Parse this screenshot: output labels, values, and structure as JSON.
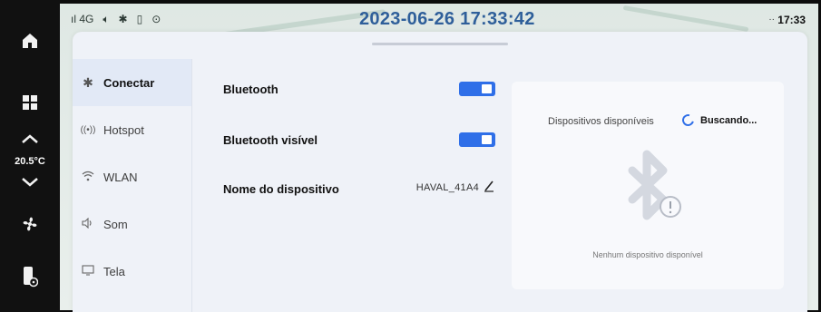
{
  "status_bar": {
    "signal": "ıl 4G",
    "icons": [
      "volume-icon",
      "bluetooth-icon",
      "phone-icon",
      "location-pin-icon"
    ],
    "datetime": "2023-06-26 17:33:42",
    "more": "··",
    "time": "17:33"
  },
  "rail": {
    "items": [
      "home-icon",
      "apps-grid-icon",
      "temp-up-icon",
      "temp-down-icon",
      "fan-icon",
      "phone-settings-icon"
    ],
    "temperature": "20.5°C"
  },
  "sidebar": {
    "items": [
      {
        "label": "Conectar",
        "icon": "bluetooth-icon",
        "active": true
      },
      {
        "label": "Hotspot",
        "icon": "hotspot-icon",
        "active": false
      },
      {
        "label": "WLAN",
        "icon": "wifi-icon",
        "active": false
      },
      {
        "label": "Som",
        "icon": "speaker-icon",
        "active": false
      },
      {
        "label": "Tela",
        "icon": "monitor-icon",
        "active": false
      }
    ]
  },
  "settings": {
    "bluetooth_label": "Bluetooth",
    "bluetooth_on": true,
    "visible_label": "Bluetooth visível",
    "visible_on": true,
    "device_name_label": "Nome do dispositivo",
    "device_name_value": "HAVAL_41A4"
  },
  "devices": {
    "title": "Dispositivos disponíveis",
    "searching": "Buscando...",
    "empty": "Nenhum dispositivo disponível"
  },
  "colors": {
    "accent": "#2f6fe8",
    "datetime": "#2f5f9a",
    "panel": "#eff2f8"
  }
}
